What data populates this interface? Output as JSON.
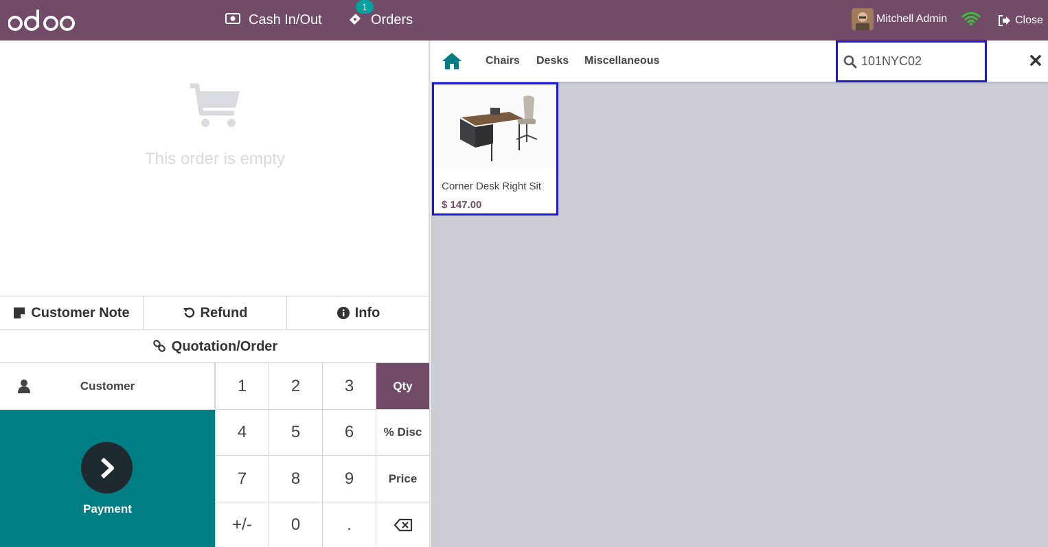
{
  "header": {
    "logo_text": "odoo",
    "cash_label": "Cash In/Out",
    "orders_label": "Orders",
    "orders_count": "1",
    "user_name": "Mitchell Admin",
    "close_label": "Close"
  },
  "order": {
    "empty_message": "This order is empty"
  },
  "controls": {
    "customer_note": "Customer Note",
    "refund": "Refund",
    "info": "Info",
    "quotation": "Quotation/Order",
    "customer": "Customer",
    "payment": "Payment"
  },
  "numpad": {
    "keys": [
      "1",
      "2",
      "3",
      "Qty",
      "4",
      "5",
      "6",
      "% Disc",
      "7",
      "8",
      "9",
      "Price",
      "+/-",
      "0",
      "."
    ],
    "active_mode": "Qty"
  },
  "categories": {
    "items": [
      "Chairs",
      "Desks",
      "Miscellaneous"
    ]
  },
  "search": {
    "value": "101NYC02"
  },
  "products": [
    {
      "name": "Corner Desk Right Sit",
      "price": "$ 147.00"
    }
  ],
  "colors": {
    "brand": "#714B67",
    "payment": "#017E84",
    "highlight": "#1a1ad6",
    "background": "#cbccd4"
  }
}
